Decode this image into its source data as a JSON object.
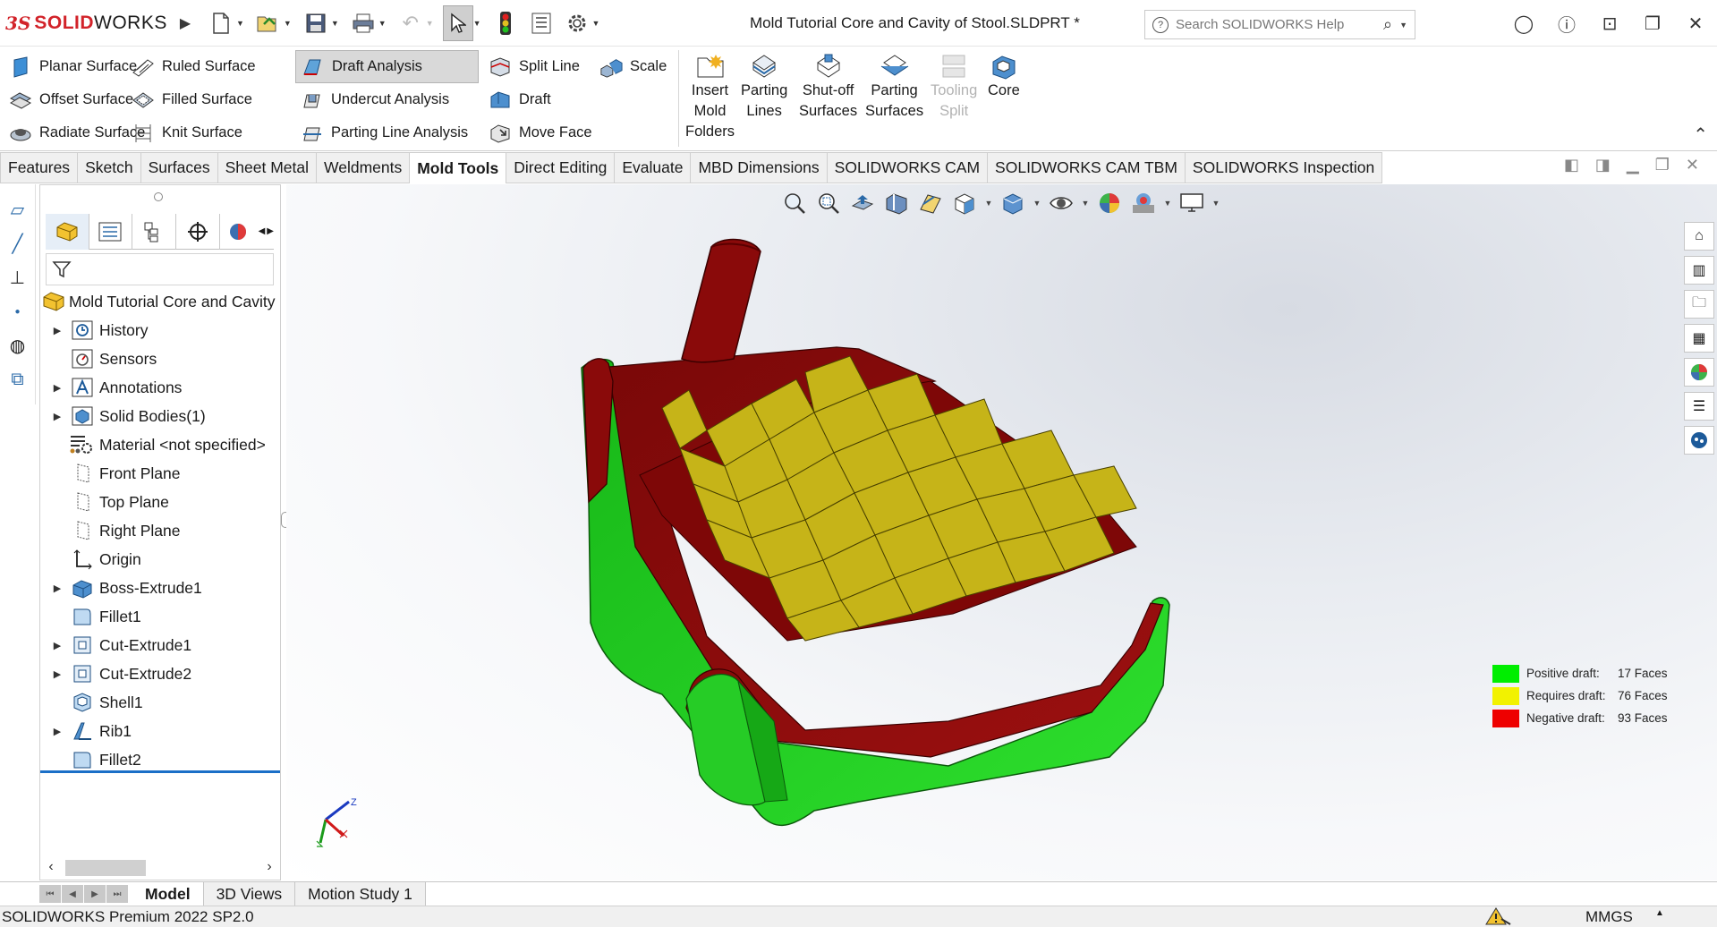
{
  "app": {
    "brand_mark": "3S",
    "brand_bold": "SOLID",
    "brand_rest": "WORKS",
    "document_title": "Mold Tutorial Core and Cavity of Stool.SLDPRT *",
    "help_search_placeholder": "Search SOLIDWORKS Help"
  },
  "ribbon": {
    "col1": [
      "Planar Surface",
      "Offset Surface",
      "Radiate Surface"
    ],
    "col2": [
      "Ruled Surface",
      "Filled Surface",
      "Knit Surface"
    ],
    "col3": [
      "Draft Analysis",
      "Undercut Analysis",
      "Parting Line Analysis"
    ],
    "col4": [
      "Split Line",
      "Draft",
      "Move Face"
    ],
    "col5": [
      "Scale"
    ],
    "big": [
      {
        "label": "Insert\nMold\nFolders",
        "disabled": false
      },
      {
        "label": "Parting\nLines",
        "disabled": false
      },
      {
        "label": "Shut-off\nSurfaces",
        "disabled": false
      },
      {
        "label": "Parting\nSurfaces",
        "disabled": false
      },
      {
        "label": "Tooling\nSplit",
        "disabled": true
      },
      {
        "label": "Core",
        "disabled": false
      }
    ]
  },
  "command_tabs": [
    "Features",
    "Sketch",
    "Surfaces",
    "Sheet Metal",
    "Weldments",
    "Mold Tools",
    "Direct Editing",
    "Evaluate",
    "MBD Dimensions",
    "SOLIDWORKS CAM",
    "SOLIDWORKS CAM TBM",
    "SOLIDWORKS Inspection"
  ],
  "active_command_tab": "Mold Tools",
  "tree": {
    "root": "Mold Tutorial Core and Cavity of Stool",
    "items": [
      {
        "label": "History",
        "expandable": true,
        "icon": "history-icon"
      },
      {
        "label": "Sensors",
        "expandable": false,
        "icon": "sensor-icon"
      },
      {
        "label": "Annotations",
        "expandable": true,
        "icon": "annotation-icon"
      },
      {
        "label": "Solid Bodies(1)",
        "expandable": true,
        "icon": "solid-body-icon"
      },
      {
        "label": "Material <not specified>",
        "expandable": false,
        "icon": "material-icon"
      },
      {
        "label": "Front Plane",
        "expandable": false,
        "icon": "plane-icon"
      },
      {
        "label": "Top Plane",
        "expandable": false,
        "icon": "plane-icon"
      },
      {
        "label": "Right Plane",
        "expandable": false,
        "icon": "plane-icon"
      },
      {
        "label": "Origin",
        "expandable": false,
        "icon": "origin-icon"
      },
      {
        "label": "Boss-Extrude1",
        "expandable": true,
        "icon": "boss-extrude-icon"
      },
      {
        "label": "Fillet1",
        "expandable": false,
        "icon": "fillet-icon"
      },
      {
        "label": "Cut-Extrude1",
        "expandable": true,
        "icon": "cut-extrude-icon"
      },
      {
        "label": "Cut-Extrude2",
        "expandable": true,
        "icon": "cut-extrude-icon"
      },
      {
        "label": "Shell1",
        "expandable": false,
        "icon": "shell-icon"
      },
      {
        "label": "Rib1",
        "expandable": true,
        "icon": "rib-icon"
      },
      {
        "label": "Fillet2",
        "expandable": false,
        "icon": "fillet-icon"
      }
    ]
  },
  "legend": [
    {
      "label": "Positive draft:",
      "value": "17 Faces",
      "color": "#00ee00"
    },
    {
      "label": "Requires draft:",
      "value": "76 Faces",
      "color": "#f2f200"
    },
    {
      "label": "Negative draft:",
      "value": "93 Faces",
      "color": "#ee0000"
    }
  ],
  "triad": {
    "z": "Z"
  },
  "bottom_tabs": [
    "Model",
    "3D Views",
    "Motion Study 1"
  ],
  "active_bottom_tab": "Model",
  "status": {
    "product": "SOLIDWORKS Premium 2022 SP2.0",
    "units": "MMGS"
  },
  "colors": {
    "brand": "#d2232a",
    "model_red": "#8c0a0a",
    "model_yellow": "#c8b41a",
    "model_green": "#1ec81e",
    "accent_blue": "#1b6fc7"
  }
}
